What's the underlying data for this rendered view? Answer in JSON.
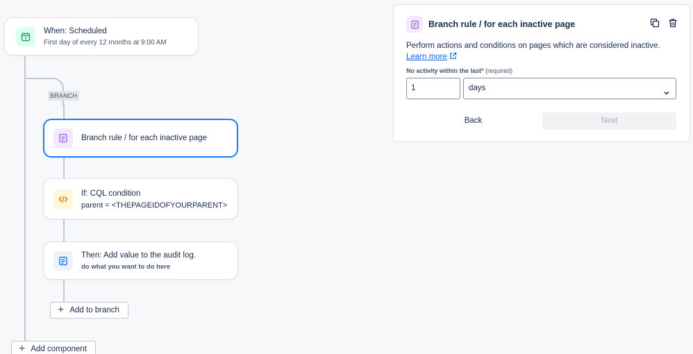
{
  "trigger": {
    "title": "When: Scheduled",
    "subtitle": "First day of every 12 months at 9:00 AM",
    "icon": "calendar-icon"
  },
  "branch_tag": "BRANCH",
  "branch_rule": {
    "title": "Branch rule / for each inactive page",
    "icon": "document-icon"
  },
  "condition": {
    "title": "If: CQL condition",
    "subtitle": "parent = <THEPAGEIDOFYOURPARENT>",
    "icon": "code-icon"
  },
  "action": {
    "title": "Then: Add value to the audit log.",
    "subtitle": "do what you want to do here",
    "icon": "audit-log-icon"
  },
  "add_to_branch": "Add to branch",
  "add_component": "Add component",
  "panel": {
    "title": "Branch rule / for each inactive page",
    "description": "Perform actions and conditions on pages which are considered inactive.",
    "learn_more": "Learn more",
    "field_label": "No activity within the last",
    "field_required_mark": "*",
    "field_required_text": "(required)",
    "field_value": "1",
    "unit_selected": "days",
    "back_label": "Back",
    "next_label": "Next"
  },
  "colors": {
    "accent": "#1d7afc",
    "trigger_icon_bg": "#dcfff1",
    "trigger_icon": "#22a06b",
    "branch_icon_bg": "#f3e8fd",
    "branch_icon": "#9f5fd6",
    "condition_icon_bg": "#fff7d6",
    "condition_icon": "#d97008",
    "action_icon_bg": "#e9f2ff",
    "action_icon": "#0c66e4"
  }
}
